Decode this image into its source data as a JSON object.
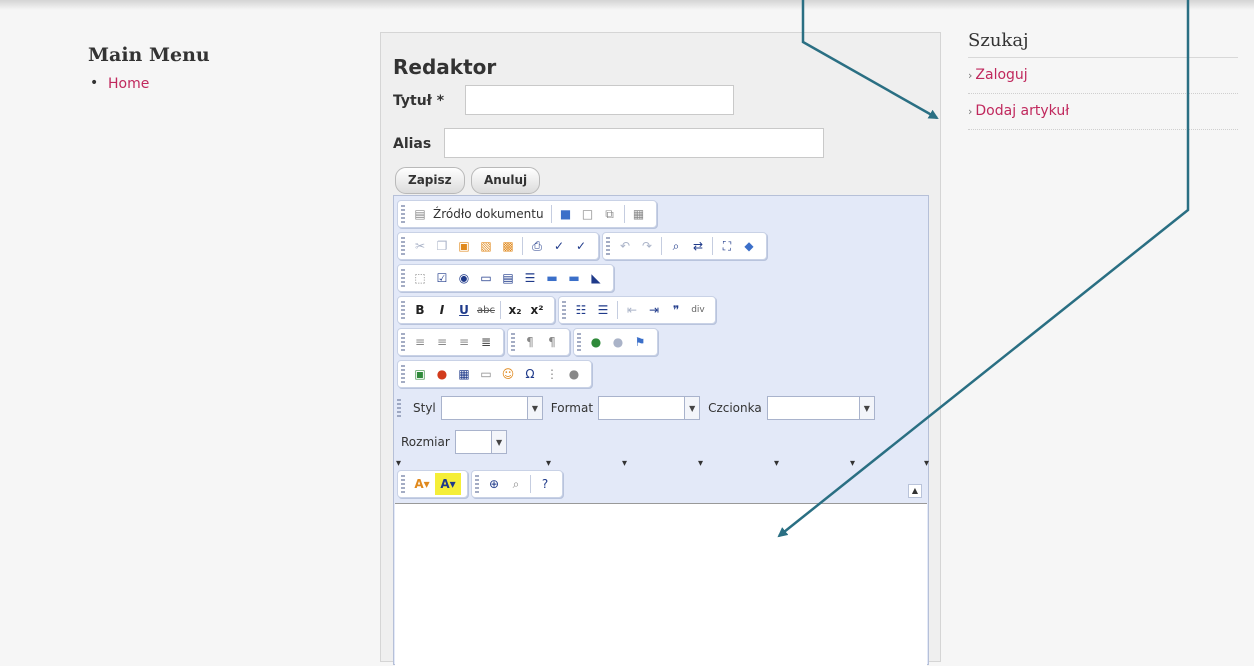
{
  "menu": {
    "title": "Main Menu",
    "items": [
      {
        "label": "Home"
      }
    ]
  },
  "sidebar": {
    "search_title": "Szukaj",
    "links": [
      {
        "label": "Zaloguj"
      },
      {
        "label": "Dodaj artykuł"
      }
    ]
  },
  "editor": {
    "heading": "Redaktor",
    "title_label": "Tytuł *",
    "title_value": "",
    "alias_label": "Alias",
    "alias_value": "",
    "save_label": "Zapisz",
    "cancel_label": "Anuluj",
    "source_label": "Źródło dokumentu",
    "style_label": "Styl",
    "format_label": "Format",
    "font_label": "Czcionka",
    "size_label": "Rozmiar",
    "div_label": "div",
    "content": ""
  },
  "colors": {
    "link": "#c0285d",
    "arrow": "#2a6f83",
    "toolbar_bg": "#e3e9f8"
  }
}
